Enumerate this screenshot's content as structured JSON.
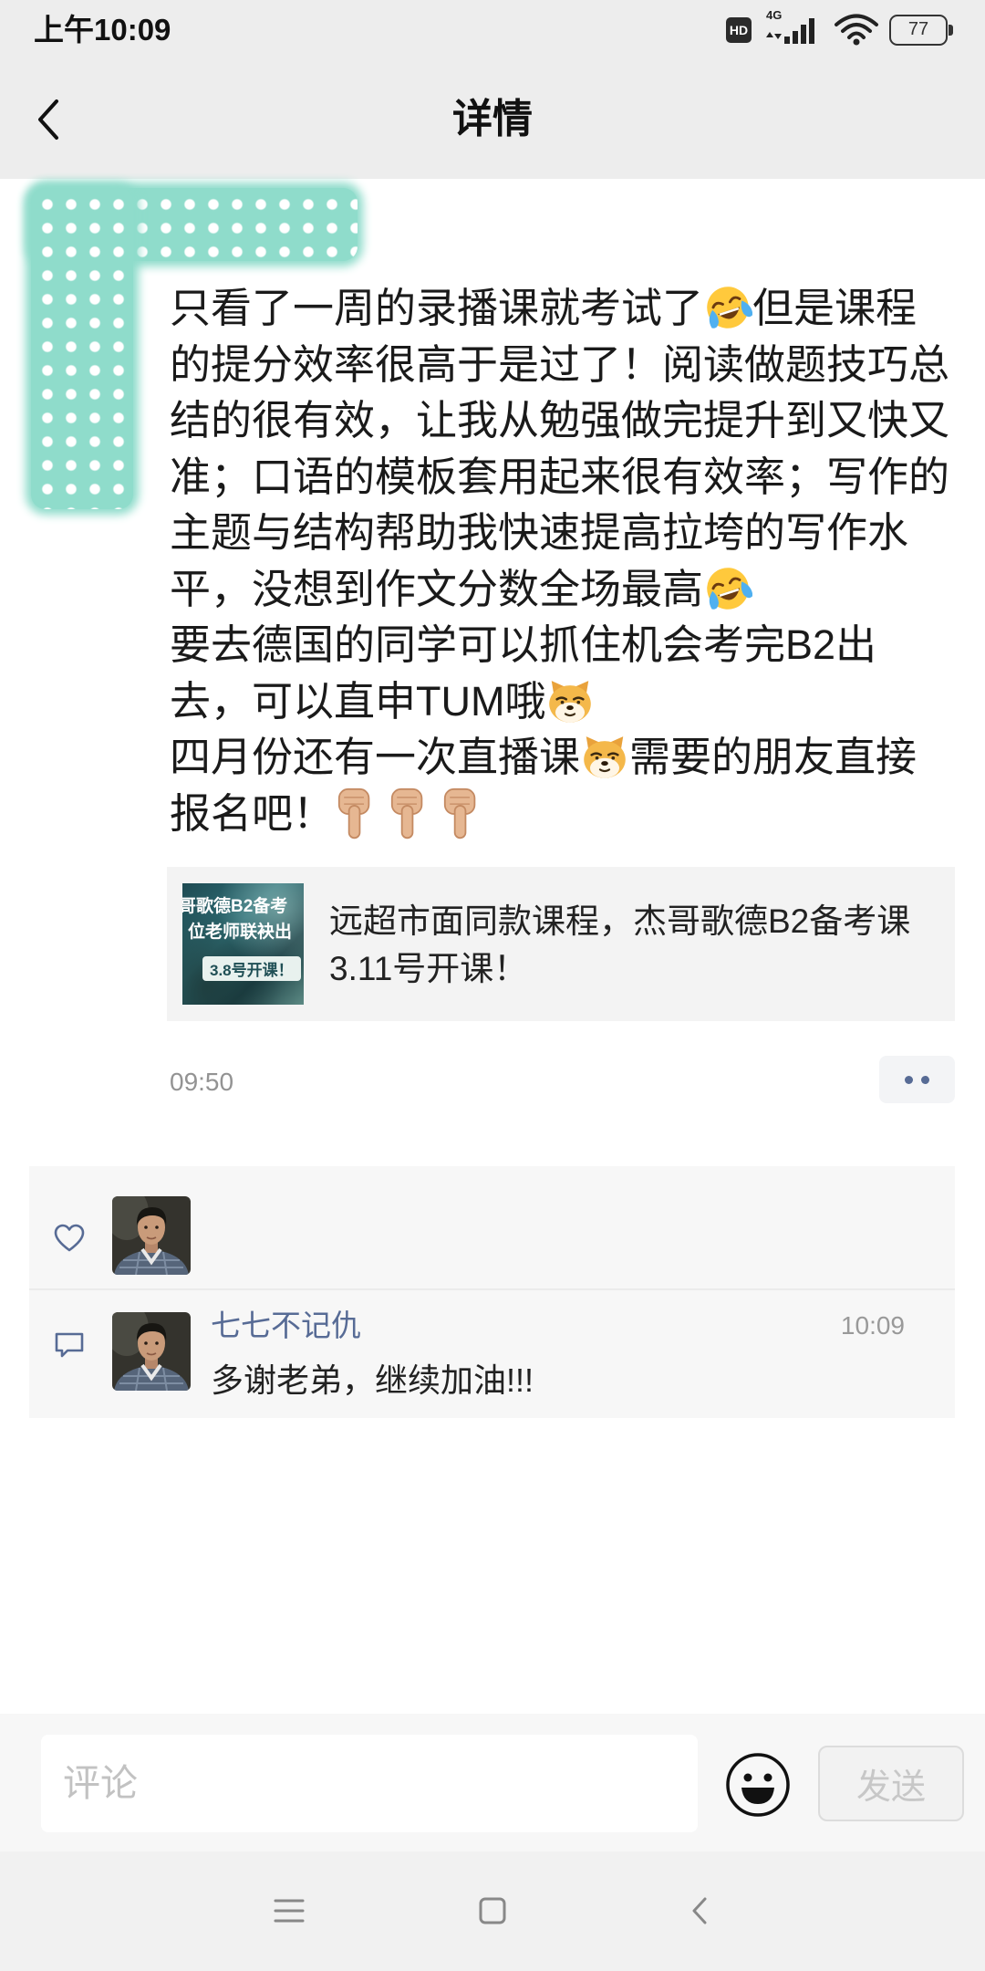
{
  "status_bar": {
    "time": "上午10:09",
    "hd_badge": "HD",
    "network_type": "4G",
    "battery_level": "77",
    "icons": [
      "hd-icon",
      "signal-icon",
      "wifi-icon",
      "battery-icon"
    ]
  },
  "header": {
    "title": "详情",
    "back_icon": "chevron-left-icon"
  },
  "post": {
    "lines": [
      [
        {
          "text": "只看了一周的录播课就考试了"
        },
        {
          "icon": "tears-of-joy-emoji"
        },
        {
          "text": "但是课程"
        }
      ],
      [
        {
          "text": "的提分效率很高于是过了！阅读做题技巧总"
        }
      ],
      [
        {
          "text": "结的很有效，让我从勉强做完提升到又快又"
        }
      ],
      [
        {
          "text": "准；口语的模板套用起来很有效率；写作的"
        }
      ],
      [
        {
          "text": "主题与结构帮助我快速提高拉垮的写作水"
        }
      ],
      [
        {
          "text": "平，没想到作文分数全场最高"
        },
        {
          "icon": "tears-of-joy-emoji"
        }
      ],
      [
        {
          "text": "要去德国的同学可以抓住机会考完B2出"
        }
      ],
      [
        {
          "text": "去，可以直申TUM哦"
        },
        {
          "icon": "doge-emoji"
        }
      ],
      [
        {
          "text": "四月份还有一次直播课"
        },
        {
          "icon": "doge-emoji"
        },
        {
          "text": "需要的朋友直接"
        }
      ],
      [
        {
          "text": "报名吧！"
        },
        {
          "icon": "pointing-down-emoji"
        },
        {
          "icon": "pointing-down-emoji"
        },
        {
          "icon": "pointing-down-emoji"
        }
      ]
    ],
    "link_card": {
      "thumbnail_lines": [
        "哥歌德B2备考",
        "位老师联袂出"
      ],
      "thumbnail_badge": "3.8号开课！",
      "title_lines": [
        "远超市面同款课程，杰哥歌德B2备考课",
        "3.11号开课！"
      ]
    },
    "time": "09:50",
    "more_icon": "more-dots-icon"
  },
  "interactions": {
    "like_icon": "heart-icon",
    "likes": [
      {
        "avatar": "avatar-photo"
      }
    ],
    "comment_icon": "comment-icon",
    "comments": [
      {
        "author": "七七不记仇",
        "time": "10:09",
        "text": "多谢老弟，继续加油!!!"
      }
    ]
  },
  "comment_bar": {
    "placeholder": "评论",
    "emoji_icon": "smiley-icon",
    "send_label": "发送"
  },
  "nav_bar": {
    "icons": [
      "menu-icon",
      "home-square-icon",
      "back-triangle-icon"
    ]
  },
  "colors": {
    "accent": "#576b95",
    "chrome_bg": "#ededed",
    "panel_bg": "#f7f7f7",
    "redaction_teal": "#8fdccb"
  }
}
